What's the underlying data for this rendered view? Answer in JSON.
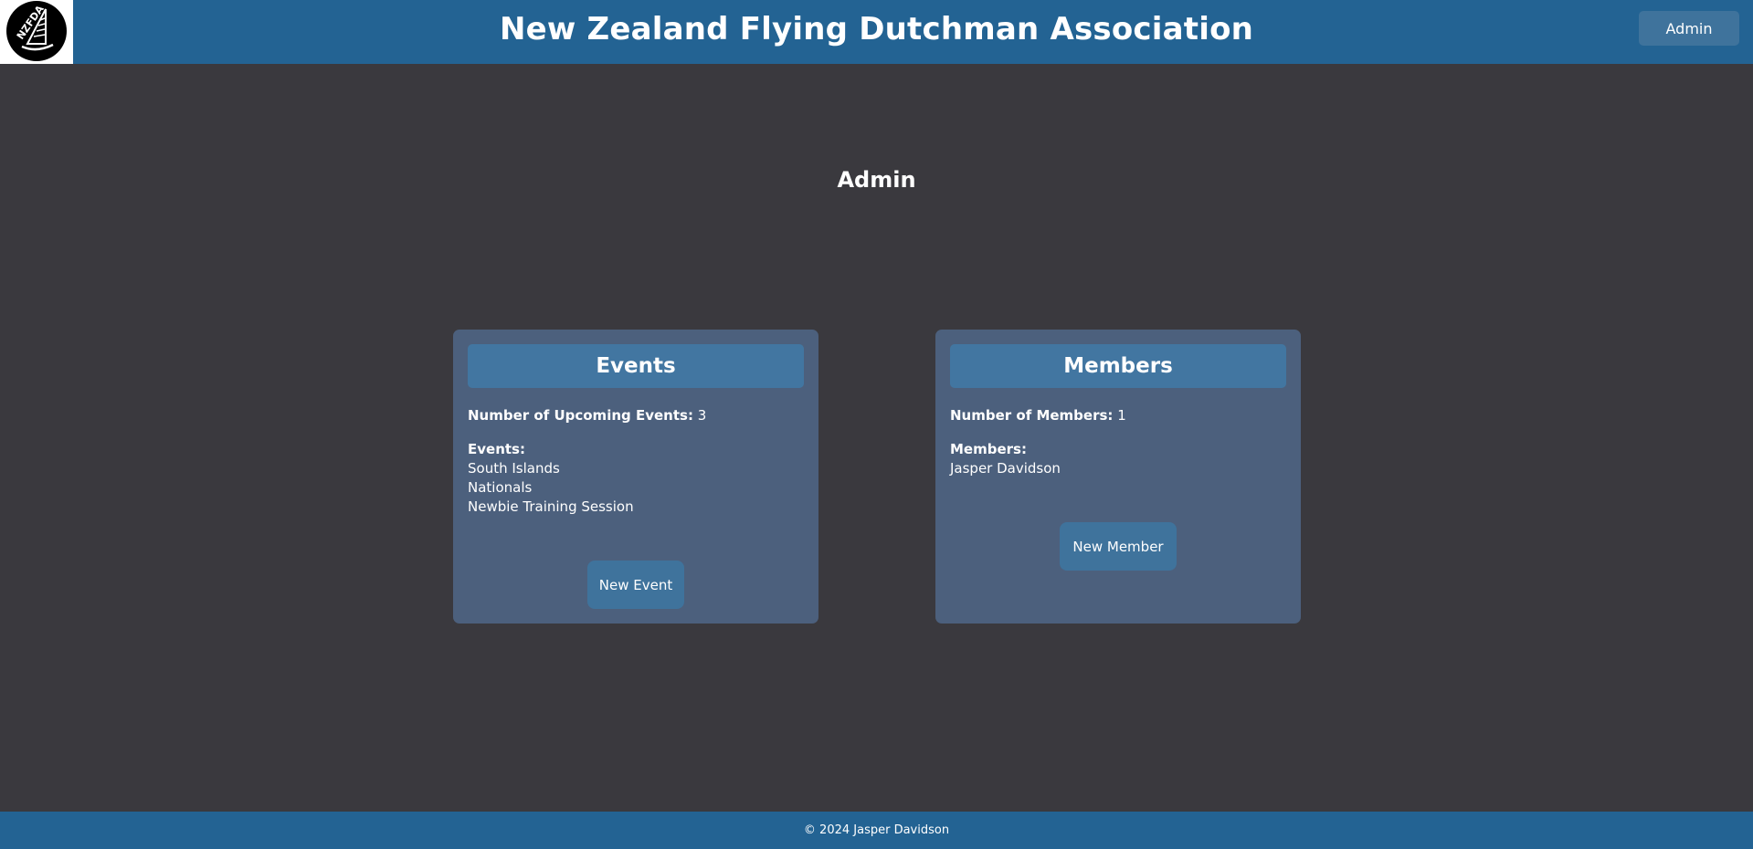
{
  "header": {
    "logo_text": "NZFDA",
    "title": "New Zealand Flying Dutchman Association",
    "admin_button": "Admin"
  },
  "page": {
    "heading": "Admin"
  },
  "events_card": {
    "title": "Events",
    "count_label": "Number of Upcoming Events:",
    "count_value": "3",
    "list_label": "Events:",
    "items": [
      "South Islands",
      "Nationals",
      "Newbie Training Session"
    ],
    "button": "New Event"
  },
  "members_card": {
    "title": "Members",
    "count_label": "Number of Members:",
    "count_value": "1",
    "list_label": "Members:",
    "items": [
      "Jasper Davidson"
    ],
    "button": "New Member"
  },
  "footer": {
    "text": "© 2024 Jasper Davidson"
  },
  "colors": {
    "header_bg": "#236393",
    "page_bg": "#3a393e",
    "card_bg": "#4c607d",
    "accent": "#4276a1",
    "button_bg": "#3f739c"
  },
  "icons": {
    "logo": "sailboat-logo-icon"
  }
}
